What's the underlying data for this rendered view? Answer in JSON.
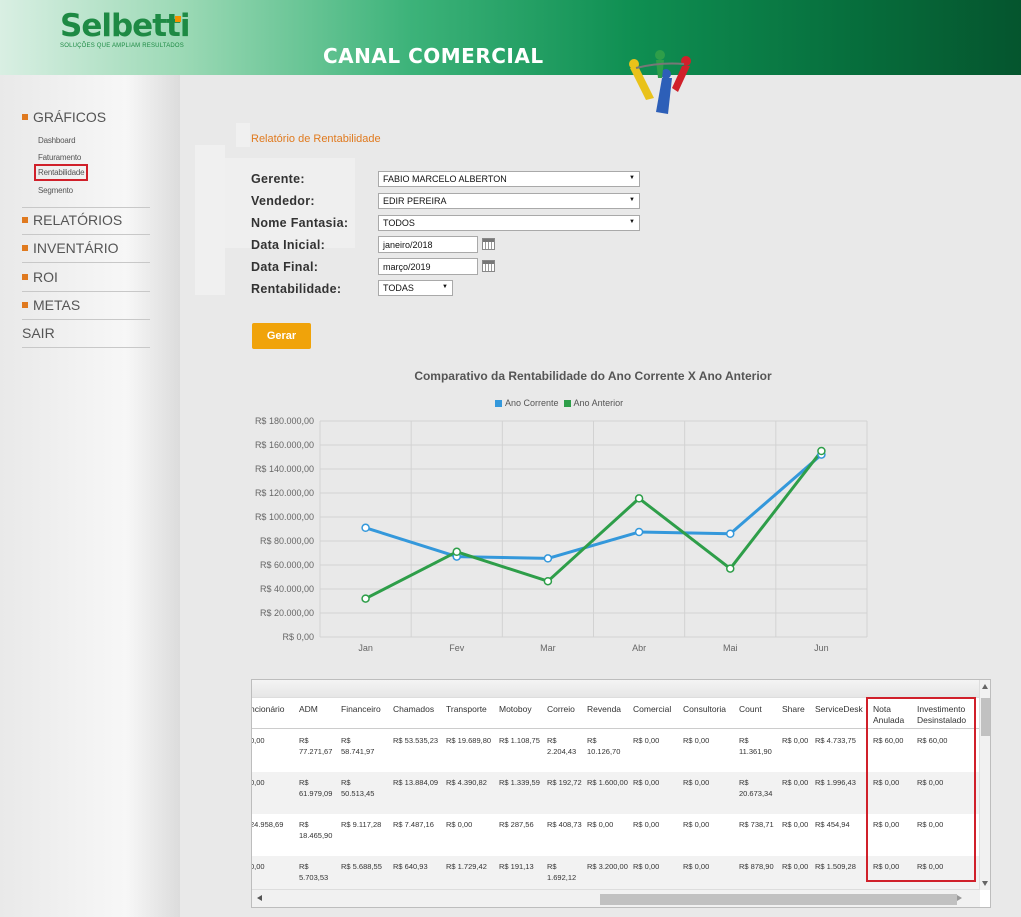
{
  "header": {
    "logo": "Selbetti",
    "tagline": "SOLUÇÕES QUE AMPLIAM RESULTADOS",
    "title": "CANAL COMERCIAL"
  },
  "sidebar": {
    "sections": [
      {
        "label": "GRÁFICOS",
        "bullet": true,
        "items": [
          "Dashboard",
          "Faturamento",
          "Rentabilidade",
          "Segmento"
        ],
        "active_item": "Rentabilidade"
      },
      {
        "label": "RELATÓRIOS",
        "bullet": true
      },
      {
        "label": "INVENTÁRIO",
        "bullet": true
      },
      {
        "label": "ROI",
        "bullet": true
      },
      {
        "label": "METAS",
        "bullet": true
      },
      {
        "label": "SAIR",
        "bullet": false
      }
    ]
  },
  "report": {
    "title": "Relatório de Rentabilidade",
    "fields": {
      "gerente": {
        "label": "Gerente:",
        "value": "FABIO MARCELO ALBERTON"
      },
      "vendedor": {
        "label": "Vendedor:",
        "value": "EDIR PEREIRA"
      },
      "nome_fantasia": {
        "label": "Nome Fantasia:",
        "value": "TODOS"
      },
      "data_inicial": {
        "label": "Data Inicial:",
        "value": "janeiro/2018"
      },
      "data_final": {
        "label": "Data Final:",
        "value": "março/2019"
      },
      "rentabilidade": {
        "label": "Rentabilidade:",
        "value": "TODAS"
      }
    },
    "generate_label": "Gerar"
  },
  "chart_data": {
    "type": "line",
    "title": "Comparativo da Rentabilidade do Ano Corrente X Ano Anterior",
    "categories": [
      "Jan",
      "Fev",
      "Mar",
      "Abr",
      "Mai",
      "Jun"
    ],
    "series": [
      {
        "name": "Ano Corrente",
        "color": "#3498db",
        "values": [
          91000,
          67000,
          65500,
          87500,
          86000,
          152000
        ]
      },
      {
        "name": "Ano Anterior",
        "color": "#2e9e49",
        "values": [
          32000,
          71000,
          46500,
          115500,
          57000,
          155000
        ]
      }
    ],
    "ylim": [
      0,
      180000
    ],
    "y_ticks": [
      "R$ 0,00",
      "R$ 20.000,00",
      "R$ 40.000,00",
      "R$ 60.000,00",
      "R$ 80.000,00",
      "R$ 100.000,00",
      "R$ 120.000,00",
      "R$ 140.000,00",
      "R$ 160.000,00",
      "R$ 180.000,00"
    ],
    "legend": "top-center",
    "grid": true
  },
  "table": {
    "columns": [
      "ncionário",
      "ADM",
      "Financeiro",
      "Chamados",
      "Transporte",
      "Motoboy",
      "Correio",
      "Revenda",
      "Comercial",
      "Consultoria",
      "Count",
      "Share",
      "ServiceDesk",
      "Nota Anulada",
      "Investimento Desinstalado"
    ],
    "rows": [
      [
        "0,00",
        "R$ 77.271,67",
        "R$ 58.741,97",
        "R$ 53.535,23",
        "R$ 19.689,80",
        "R$ 1.108,75",
        "R$ 2.204,43",
        "R$ 10.126,70",
        "R$ 0,00",
        "R$ 0,00",
        "R$ 11.361,90",
        "R$ 0,00",
        "R$ 4.733,75",
        "R$ 60,00",
        "R$ 60,00"
      ],
      [
        "0,00",
        "R$ 61.979,09",
        "R$ 50.513,45",
        "R$ 13.884,09",
        "R$ 4.390,82",
        "R$ 1.339,59",
        "R$ 192,72",
        "R$ 1.600,00",
        "R$ 0,00",
        "R$ 0,00",
        "R$ 20.673,34",
        "R$ 0,00",
        "R$ 1.996,43",
        "R$ 0,00",
        "R$ 0,00"
      ],
      [
        "24.958,69",
        "R$ 18.465,90",
        "R$ 9.117,28",
        "R$ 7.487,16",
        "R$ 0,00",
        "R$ 287,56",
        "R$ 408,73",
        "R$ 0,00",
        "R$ 0,00",
        "R$ 0,00",
        "R$ 738,71",
        "R$ 0,00",
        "R$ 454,94",
        "R$ 0,00",
        "R$ 0,00"
      ],
      [
        "0,00",
        "R$ 5.703,53",
        "R$ 5.688,55",
        "R$ 640,93",
        "R$ 1.729,42",
        "R$ 191,13",
        "R$ 1.692,12",
        "R$ 3.200,00",
        "R$ 0,00",
        "R$ 0,00",
        "R$ 878,90",
        "R$ 0,00",
        "R$ 1.509,28",
        "R$ 0,00",
        "R$ 0,00"
      ]
    ]
  }
}
